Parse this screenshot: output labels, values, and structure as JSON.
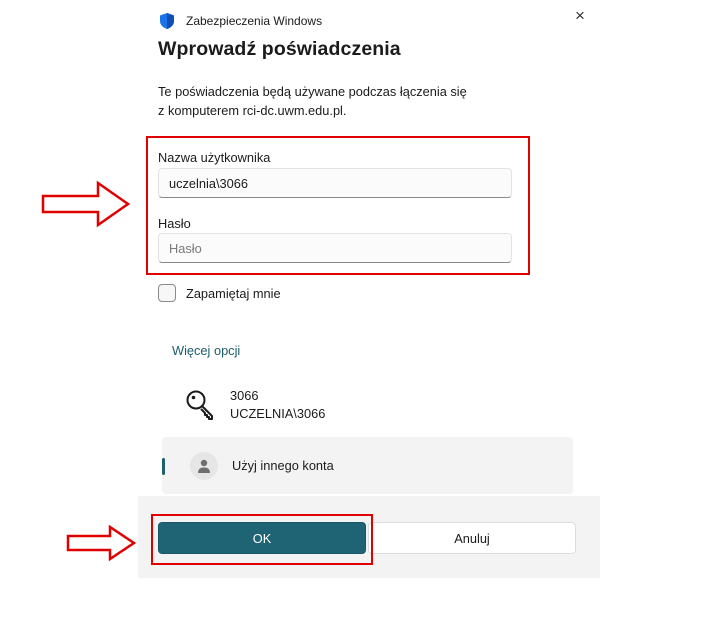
{
  "window": {
    "app_title": "Zabezpieczenia Windows",
    "close_glyph": "×"
  },
  "dialog": {
    "heading": "Wprowadź poświadczenia",
    "description_line1": "Te poświadczenia będą używane podczas łączenia się",
    "description_line2": "z komputerem rci-dc.uwm.edu.pl."
  },
  "form": {
    "username_label": "Nazwa użytkownika",
    "username_value": "uczelnia\\3066",
    "password_label": "Hasło",
    "password_placeholder": "Hasło",
    "remember_label": "Zapamiętaj mnie",
    "remember_checked": false
  },
  "options": {
    "more_label": "Więcej opcji",
    "accounts": [
      {
        "icon": "key-icon",
        "line1": "3066",
        "line2": "UCZELNIA\\3066"
      },
      {
        "icon": "person-icon",
        "label": "Użyj innego konta",
        "selected": true
      }
    ]
  },
  "buttons": {
    "ok_label": "OK",
    "cancel_label": "Anuluj"
  },
  "annotations": {
    "highlight_color": "#e00000",
    "arrow_count": 2
  },
  "colors": {
    "accent": "#1f6474",
    "link": "#1a5c6b",
    "shield_blue": "#1a73e8"
  }
}
